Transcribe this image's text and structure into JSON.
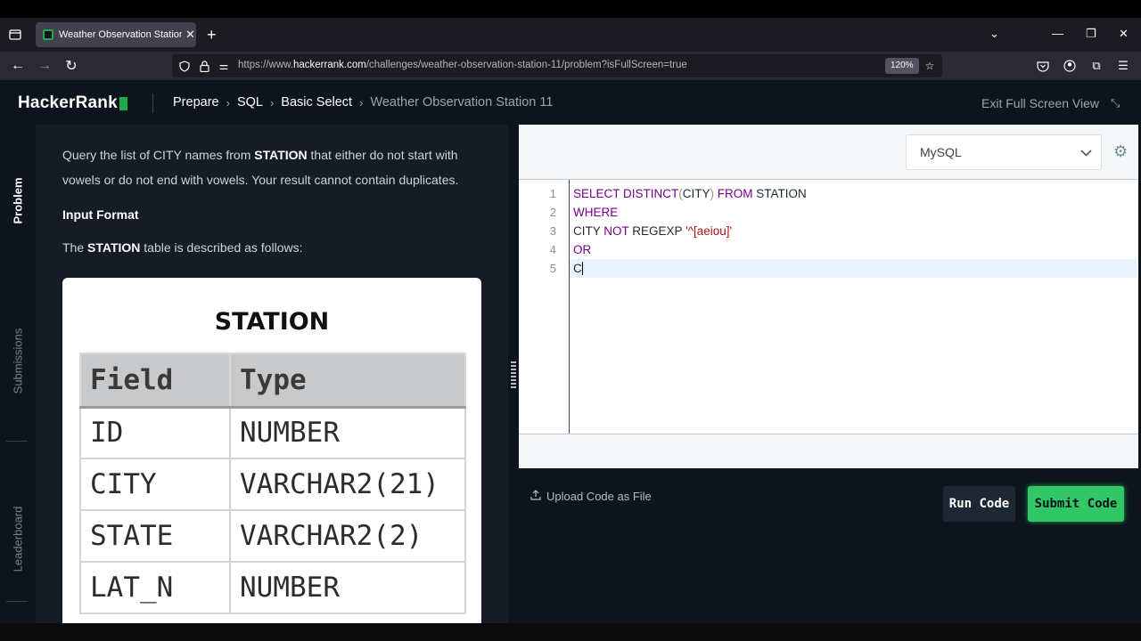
{
  "browser": {
    "tab_title": "Weather Observation Station 11",
    "url_prefix": "https://www.",
    "url_domain": "hackerrank.com",
    "url_path": "/challenges/weather-observation-station-11/problem?isFullScreen=true",
    "zoom": "120%"
  },
  "header": {
    "logo": "HackerRank",
    "breadcrumbs": [
      "Prepare",
      "SQL",
      "Basic Select",
      "Weather Observation Station 11"
    ],
    "exit_fullscreen": "Exit Full Screen View"
  },
  "side_tabs": [
    "Problem",
    "Submissions",
    "Leaderboard"
  ],
  "problem": {
    "line1_a": "Query the list of CITY names from ",
    "line1_b": "STATION",
    "line1_c": " that either do not start with",
    "line2": "vowels or do not end with vowels. Your result cannot contain duplicates.",
    "input_heading": "Input Format",
    "desc_a": "The ",
    "desc_b": "STATION",
    "desc_c": " table is described as follows:",
    "table_title": "STATION",
    "table_headers": [
      "Field",
      "Type"
    ],
    "table_rows": [
      [
        "ID",
        "NUMBER"
      ],
      [
        "CITY",
        "VARCHAR2(21)"
      ],
      [
        "STATE",
        "VARCHAR2(2)"
      ],
      [
        "LAT_N",
        "NUMBER"
      ]
    ]
  },
  "editor": {
    "language": "MySQL",
    "line_numbers": [
      "1",
      "2",
      "3",
      "4",
      "5"
    ],
    "code": {
      "l1_kw1": "SELECT DISTINCT",
      "l1_p1": "(",
      "l1_id": "CITY",
      "l1_p2": ")",
      "l1_kw2": " FROM ",
      "l1_tbl": "STATION",
      "l2_kw": "WHERE",
      "l3_id": "CITY ",
      "l3_kw": "NOT",
      "l3_rest": " REGEXP ",
      "l3_str": "'^[aeiou]'",
      "l4_kw": "OR",
      "l5_text": "C"
    }
  },
  "actions": {
    "upload": "Upload Code as File",
    "run": "Run Code",
    "submit": "Submit Code"
  },
  "colors": {
    "accent": "#1ba94c",
    "submit_bg": "#32c766",
    "keyword": "#770088"
  }
}
